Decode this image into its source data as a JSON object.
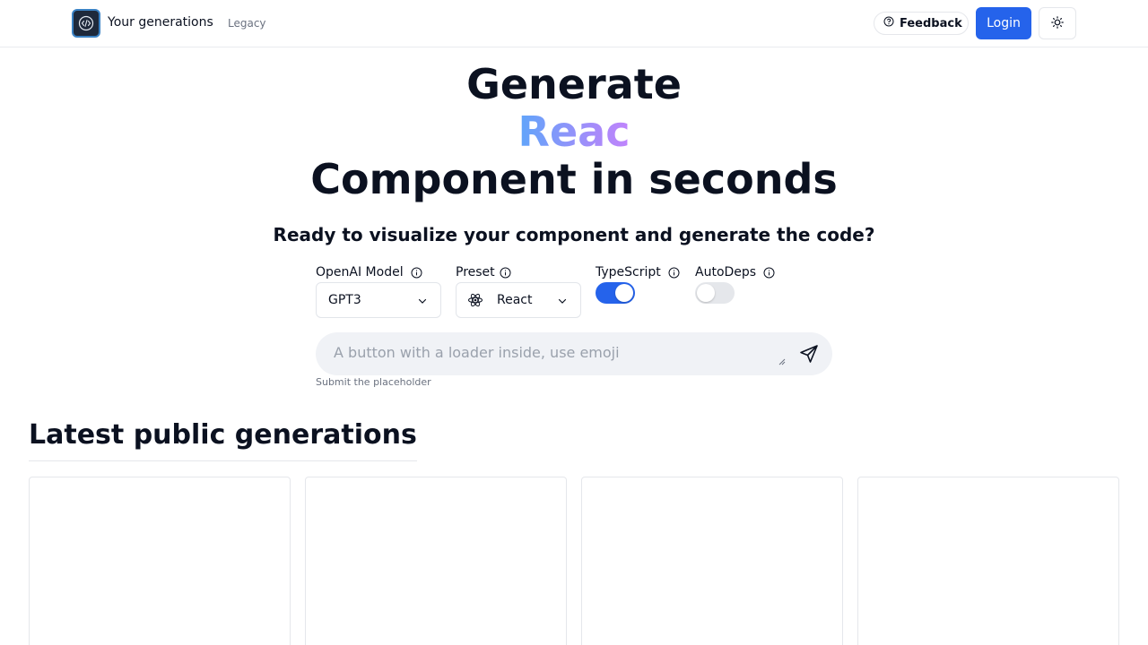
{
  "header": {
    "brand": "Your generations",
    "legacy": "Legacy",
    "feedback": "Feedback",
    "login": "Login",
    "icons": [
      "code-logo-icon",
      "help-circle-icon",
      "sun-icon"
    ]
  },
  "hero": {
    "line1": "Generate",
    "line2": "Reac",
    "line3": "Component in seconds",
    "subtitle": "Ready to visualize your component and generate the code?"
  },
  "options": {
    "model": {
      "label": "OpenAI Model",
      "value": "GPT3"
    },
    "preset": {
      "label": "Preset",
      "value": "React",
      "icon": "react-atom-icon"
    },
    "typescript": {
      "label": "TypeScript",
      "enabled": true
    },
    "autodeps": {
      "label": "AutoDeps",
      "enabled": false
    }
  },
  "prompt": {
    "placeholder": "A button with a loader inside, use emoji",
    "hint": "Submit the placeholder"
  },
  "latest": {
    "title": "Latest public generations"
  },
  "colors": {
    "primary": "#2563eb",
    "text": "#0b1120",
    "muted": "#6b7280",
    "gradient_start": "#60a5fa",
    "gradient_end": "#c084fc"
  }
}
